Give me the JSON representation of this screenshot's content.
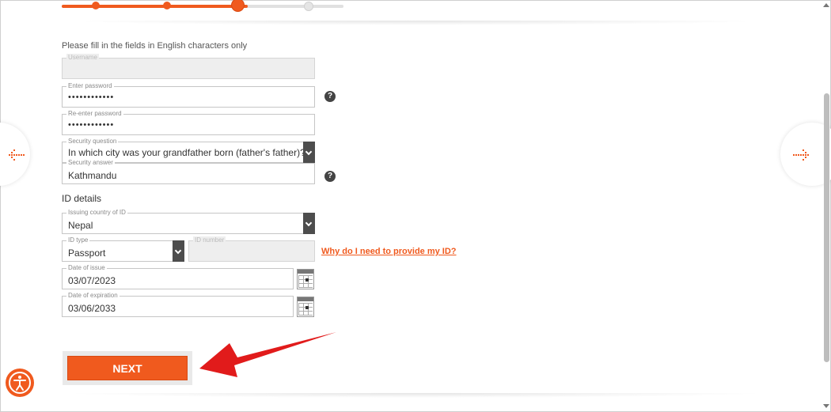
{
  "progress": {
    "steps": 4,
    "current_step": 3,
    "fill_fraction": 0.66
  },
  "form": {
    "note": "Please fill in the fields in English characters only",
    "username": {
      "label": "Username",
      "value": ""
    },
    "password": {
      "label": "Enter password",
      "value": "••••••••••••"
    },
    "reenter_password": {
      "label": "Re-enter password",
      "value": "••••••••••••"
    },
    "security_question": {
      "label": "Security question",
      "value": "In which city was your grandfather born (father's father)?"
    },
    "security_answer": {
      "label": "Security answer",
      "value": "Kathmandu"
    },
    "help_glyph": "?"
  },
  "id_details": {
    "heading": "ID details",
    "country": {
      "label": "Issuing country of ID",
      "value": "Nepal"
    },
    "id_type": {
      "label": "ID type",
      "value": "Passport"
    },
    "id_number": {
      "label": "ID number",
      "value": ""
    },
    "why_link": "Why do I need to provide my ID?",
    "date_of_issue": {
      "label": "Date of issue",
      "value": "03/07/2023"
    },
    "date_of_expiration": {
      "label": "Date of expiration",
      "value": "03/06/2033"
    }
  },
  "actions": {
    "next_label": "NEXT"
  },
  "icons": {
    "prev": "back-arrow-icon",
    "next": "forward-arrow-icon",
    "accessibility": "accessibility-icon",
    "calendar": "calendar-icon",
    "dropdown": "chevron-down-icon",
    "help": "help-icon"
  },
  "colors": {
    "accent": "#f05a1e",
    "annotation_arrow": "#e11b1b",
    "dark": "#4d4d4d"
  }
}
